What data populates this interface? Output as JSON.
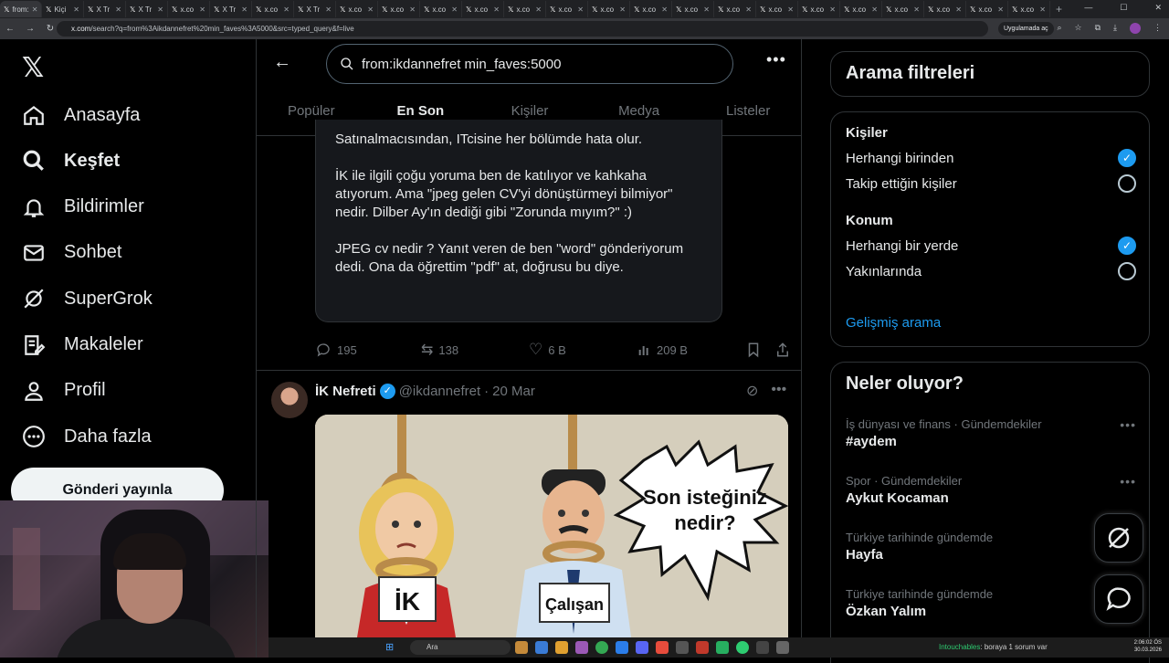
{
  "browser": {
    "tabs": [
      {
        "label": "from:",
        "active": true
      },
      {
        "label": "Kiçi"
      },
      {
        "label": "X Tr"
      },
      {
        "label": "X Tr"
      },
      {
        "label": "x.co"
      },
      {
        "label": "X Tr"
      },
      {
        "label": "x.co"
      },
      {
        "label": "X Tr"
      },
      {
        "label": "x.co"
      },
      {
        "label": "x.co"
      },
      {
        "label": "x.co"
      },
      {
        "label": "x.co"
      },
      {
        "label": "x.co"
      },
      {
        "label": "x.co"
      },
      {
        "label": "x.co"
      },
      {
        "label": "x.co"
      },
      {
        "label": "x.co"
      },
      {
        "label": "x.co"
      },
      {
        "label": "x.co"
      },
      {
        "label": "x.co"
      },
      {
        "label": "x.co"
      },
      {
        "label": "x.co"
      },
      {
        "label": "x.co"
      },
      {
        "label": "x.co"
      },
      {
        "label": "x.co"
      }
    ],
    "url_host": "x.com",
    "url_path": "/search?q=from%3Aikdannefret%20min_faves%3A5000&src=typed_query&f=live",
    "app_button": "Uygulamada aç"
  },
  "sidebar": {
    "items": [
      {
        "label": "Anasayfa",
        "icon": "home-icon"
      },
      {
        "label": "Keşfet",
        "icon": "search-icon",
        "bold": true
      },
      {
        "label": "Bildirimler",
        "icon": "bell-icon"
      },
      {
        "label": "Sohbet",
        "icon": "mail-icon"
      },
      {
        "label": "SuperGrok",
        "icon": "grok-icon"
      },
      {
        "label": "Makaleler",
        "icon": "article-icon"
      },
      {
        "label": "Profil",
        "icon": "person-icon"
      },
      {
        "label": "Daha fazla",
        "icon": "more-icon"
      }
    ],
    "post_button": "Gönderi yayınla"
  },
  "main": {
    "search_value": "from:ikdannefret min_faves:5000",
    "tabs": [
      "Popüler",
      "En Son",
      "Kişiler",
      "Medya",
      "Listeler"
    ],
    "active_tab": "En Son",
    "quote_paragraphs": [
      "Satınalmacısından, ITcisine her bölümde hata olur.",
      "İK ile ilgili çoğu yoruma ben de katılıyor ve kahkaha atıyorum. Ama \"jpeg gelen CV'yi dönüştürmeyi bilmiyor\" nedir. Dilber Ay'ın dediği gibi \"Zorunda mıyım?\" :)",
      "JPEG cv nedir ? Yanıt veren de ben \"word\" gönderiyorum dedi. Ona da öğrettim \"pdf\" at, doğrusu bu diye."
    ],
    "actions": {
      "replies": "195",
      "reposts": "138",
      "likes": "6 B",
      "views": "209 B"
    },
    "tweet2": {
      "name": "İK Nefreti",
      "handle": "@ikdannefret",
      "date": "20 Mar",
      "image_texts": {
        "bubble": "Son isteğiniz nedir?",
        "sign_left": "İK",
        "sign_right": "Çalışan"
      }
    }
  },
  "right": {
    "filters_title": "Arama filtreleri",
    "people_label": "Kişiler",
    "people_options": [
      {
        "label": "Herhangi birinden",
        "selected": true
      },
      {
        "label": "Takip ettiğin kişiler",
        "selected": false
      }
    ],
    "location_label": "Konum",
    "location_options": [
      {
        "label": "Herhangi bir yerde",
        "selected": true
      },
      {
        "label": "Yakınlarında",
        "selected": false
      }
    ],
    "advanced_search": "Gelişmiş arama",
    "trends_title": "Neler oluyor?",
    "trends": [
      {
        "category": "İş dünyası ve finans · Gündemdekiler",
        "title": "#aydem"
      },
      {
        "category": "Spor · Gündemdekiler",
        "title": "Aykut Kocaman"
      },
      {
        "category": "Türkiye tarihinde gündemde",
        "title": "Hayfa"
      },
      {
        "category": "Türkiye tarihinde gündemde",
        "title": "Özkan Yalım"
      }
    ]
  },
  "taskbar": {
    "search_placeholder": "Ara",
    "ticker_user": "Intouchables",
    "ticker_text": ": boraya 1 sorum var",
    "time": "2:06:02 ÖS",
    "date": "30.03.2026"
  },
  "colors": {
    "accent": "#1d9bf0",
    "background": "#000000",
    "border": "#2f3336",
    "muted": "#71767b"
  }
}
